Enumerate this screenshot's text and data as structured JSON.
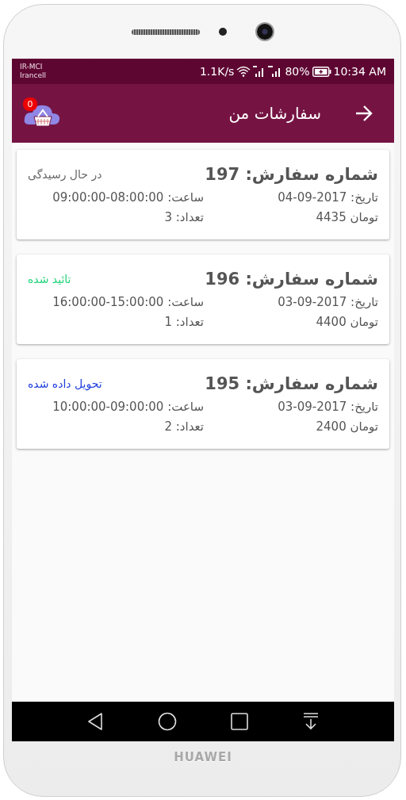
{
  "device": {
    "brand": "HUAWEI"
  },
  "status_bar": {
    "carriers": [
      "IR-MCI",
      "Irancell"
    ],
    "speed": "1.1K/s",
    "battery": "80%",
    "time": "10:34 AM"
  },
  "app_bar": {
    "title": "سفارشات من",
    "cart_count": "0"
  },
  "orders": [
    {
      "title": "شماره سفارش: 197",
      "date_label": "تاریخ:",
      "date": "04-09-2017",
      "price": "تومان  4435",
      "status": "در حال رسیدگی",
      "color": "#666666",
      "time_label": "ساعت:",
      "time": "09:00:00-08:00:00",
      "count": "تعداد: 3"
    },
    {
      "title": "شماره سفارش: 196",
      "date_label": "تاریخ:",
      "date": "03-09-2017",
      "price": "تومان  4400",
      "status": "تائید شده",
      "color": "#22d37a",
      "time_label": "ساعت:",
      "time": "16:00:00-15:00:00",
      "count": "تعداد: 1"
    },
    {
      "title": "شماره سفارش: 195",
      "date_label": "تاریخ:",
      "date": "03-09-2017",
      "price": "تومان  2400",
      "status": "تحویل داده شده",
      "color": "#1f3fdc",
      "time_label": "ساعت:",
      "time": "10:00:00-09:00:00",
      "count": "تعداد: 2"
    }
  ]
}
